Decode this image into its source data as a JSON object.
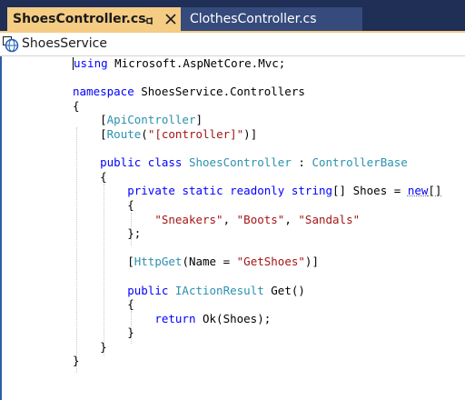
{
  "tabs": [
    {
      "label": "ShoesController.cs",
      "active": true
    },
    {
      "label": "ClothesController.cs",
      "active": false
    }
  ],
  "navbar": {
    "project": "ShoesService"
  },
  "code": {
    "using_kw": "using",
    "using_ns": " Microsoft.AspNetCore.Mvc;",
    "namespace_kw": "namespace",
    "namespace_name": " ShoesService.Controllers",
    "open_brace": "{",
    "close_brace": "}",
    "attr_open": "[",
    "attr_close": "]",
    "api_controller": "ApiController",
    "route_attr": "Route",
    "route_open": "(",
    "route_value": "\"[controller]\"",
    "route_close": ")]",
    "public_kw": "public",
    "class_kw": "class",
    "class_name": "ShoesController",
    "colon": " : ",
    "base_class": "ControllerBase",
    "private_kw": "private",
    "static_kw": "static",
    "readonly_kw": "readonly",
    "string_kw": "string",
    "field_decl": "[] Shoes = ",
    "new_kw": "new",
    "array_brackets": "[]",
    "shoe_1": "\"Sneakers\"",
    "shoe_2": "\"Boots\"",
    "shoe_3": "\"Sandals\"",
    "comma": ", ",
    "close_init": "};",
    "httpget_attr": "HttpGet",
    "httpget_name_arg": "(Name = ",
    "httpget_value": "\"GetShoes\"",
    "httpget_close": ")]",
    "return_type": "IActionResult",
    "method_sig": " Get()",
    "return_kw": "return",
    "return_expr": " Ok(Shoes);"
  },
  "colors": {
    "tab_active_bg": "#f5cc84",
    "tab_strip_bg": "#1f2f55",
    "keyword": "#0000ff",
    "type": "#2b91af",
    "string": "#a31515"
  }
}
